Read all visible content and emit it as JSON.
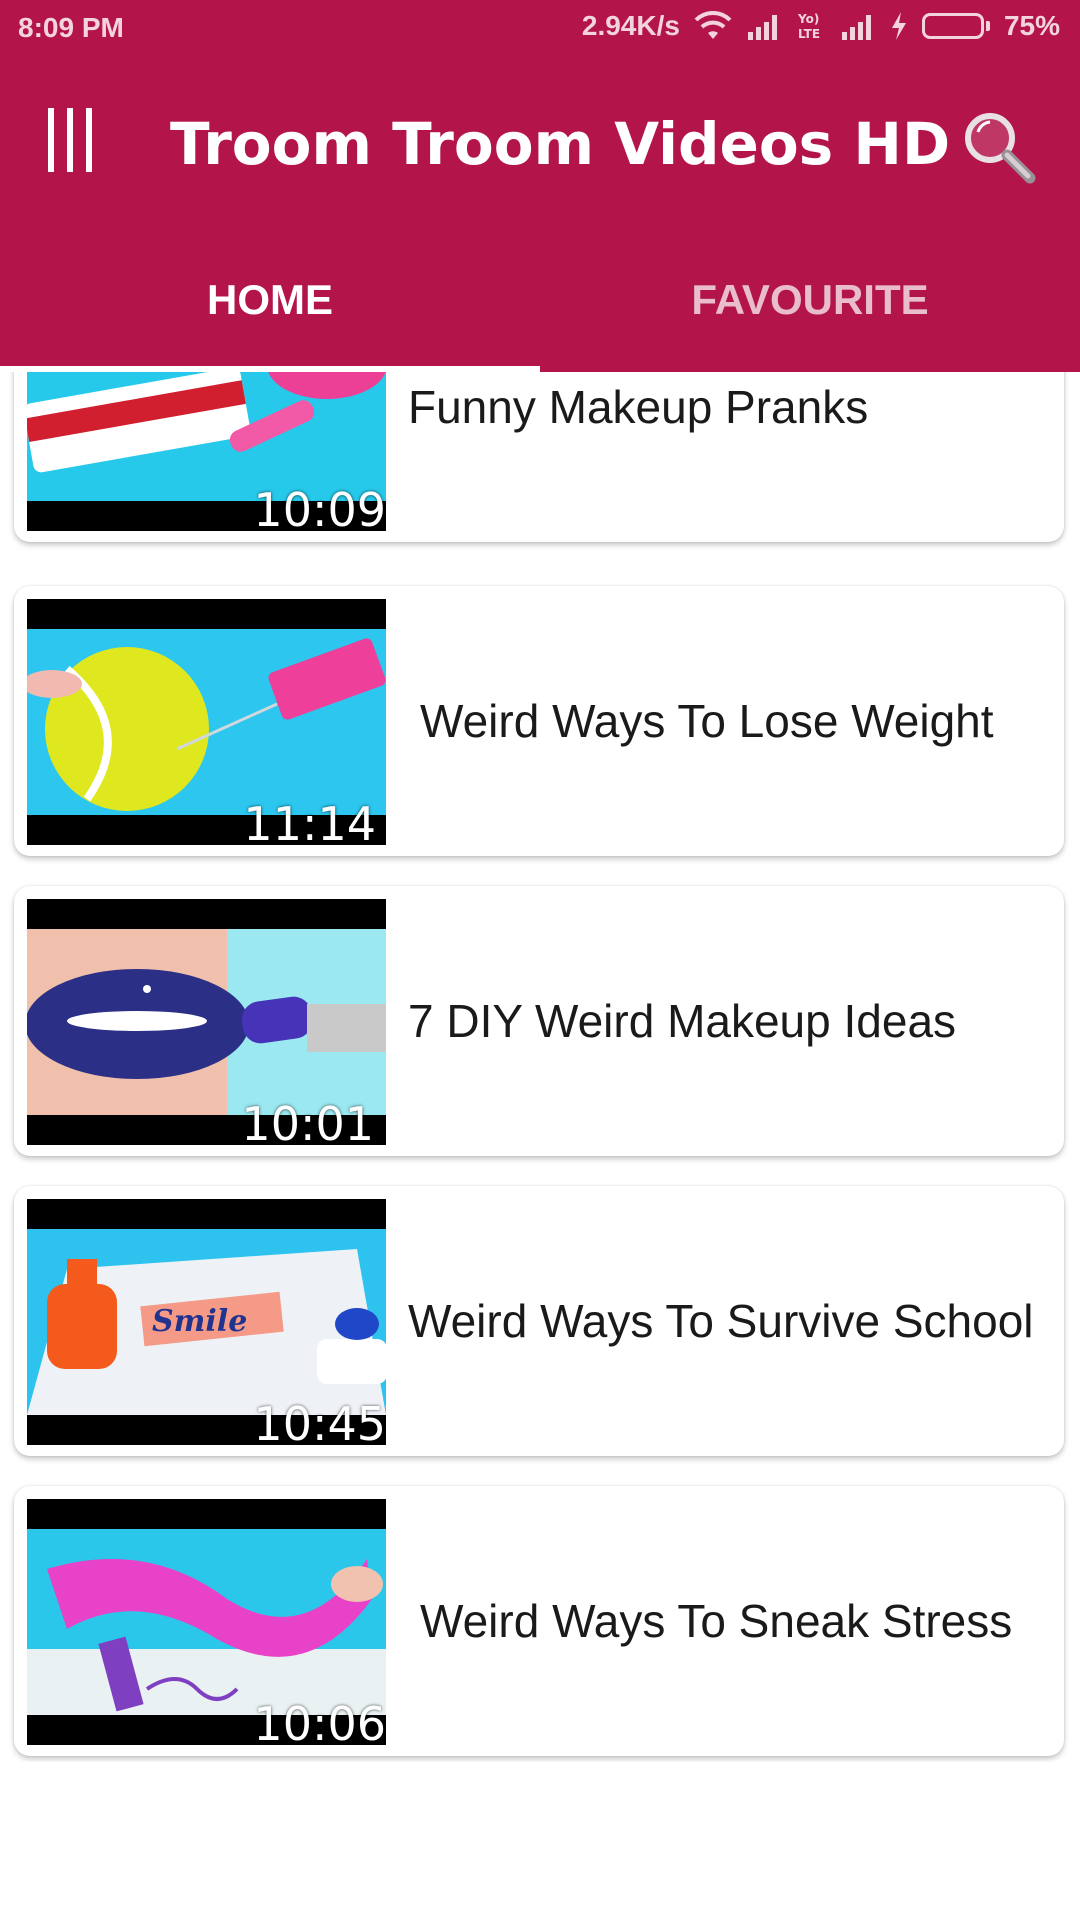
{
  "status_bar": {
    "time": "8:09 PM",
    "network_speed": "2.94K/s",
    "battery_percent": "75%",
    "battery_level": 0.75,
    "icons": [
      "wifi-icon",
      "signal-icon",
      "volte-icon",
      "signal-icon",
      "charging-icon",
      "battery-icon"
    ]
  },
  "header": {
    "title": "Troom Troom Videos HD",
    "menu_icon": "menu-icon",
    "search_icon": "search-icon",
    "background_color": "#B3154B"
  },
  "tabs": [
    {
      "label": "HOME",
      "active": true
    },
    {
      "label": "FAVOURITE",
      "active": false
    }
  ],
  "videos": [
    {
      "title": "Funny Makeup Pranks",
      "duration": "10:09"
    },
    {
      "title": "Weird Ways To Lose Weight",
      "duration": "11:14"
    },
    {
      "title": "7 DIY Weird Makeup Ideas",
      "duration": "10:01"
    },
    {
      "title": "Weird Ways To Survive School",
      "duration": "10:45"
    },
    {
      "title": "Weird Ways To Sneak Stress",
      "duration": "10:06"
    }
  ]
}
